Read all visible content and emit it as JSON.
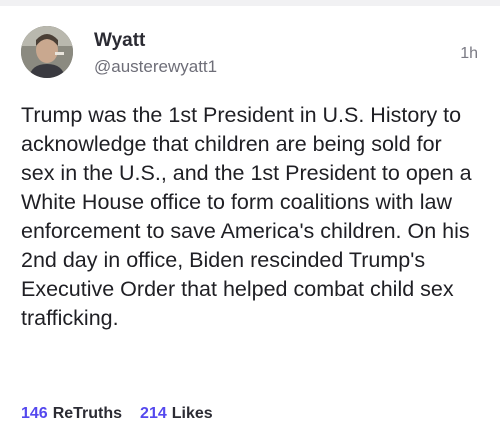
{
  "post": {
    "author": {
      "display_name": "Wyatt",
      "handle": "@austerewyatt1"
    },
    "timestamp": "1h",
    "text": "Trump was the 1st President in U.S. History to acknowledge that children are being sold for sex in the U.S., and the 1st President to open a White House office to form coalitions with law enforcement to save America's children. On his 2nd day in office, Biden rescinded Trump's Executive Order that helped combat child sex trafficking.",
    "stats": {
      "retruths_count": "146",
      "retruths_label": "ReTruths",
      "likes_count": "214",
      "likes_label": "Likes"
    }
  },
  "colors": {
    "accent": "#5448ee",
    "text": "#1f1f24",
    "muted": "#6e6e78"
  }
}
